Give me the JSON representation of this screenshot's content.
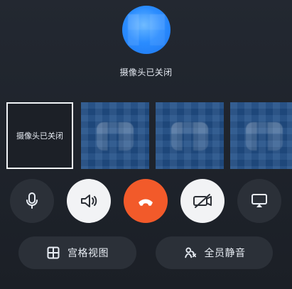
{
  "status": {
    "camera_off_label": "摄像头已关闭"
  },
  "thumbnails": {
    "self_label": "摄像头已关闭"
  },
  "controls": {
    "microphone": "mic",
    "speaker": "speaker",
    "hangup": "hang-up",
    "camera": "camera-off",
    "screen_share": "airplay"
  },
  "actions": {
    "grid_view_label": "宫格视图",
    "mute_all_label": "全员静音"
  },
  "colors": {
    "background": "#1f232a",
    "accent_hangup": "#f25a2a",
    "button_dark": "#2b3038",
    "button_light": "#f2f3f5"
  },
  "icons": {
    "grid": "grid-icon",
    "mute_all": "people-mute-icon"
  }
}
